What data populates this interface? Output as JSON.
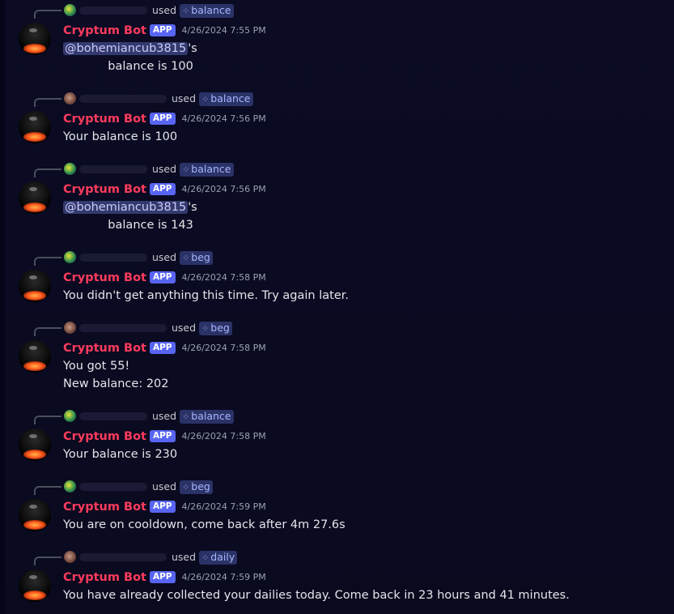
{
  "bot_name": "Cryptum Bot",
  "app_badge": "APP",
  "used_text": "used",
  "messages": [
    {
      "command": "balance",
      "timestamp": "4/26/2024 7:55 PM",
      "mention": "@bohemiancub3815",
      "suffix": "'s",
      "line2": "            balance is 100"
    },
    {
      "command": "balance",
      "timestamp": "4/26/2024 7:56 PM",
      "line1": "Your balance is 100"
    },
    {
      "command": "balance",
      "timestamp": "4/26/2024 7:56 PM",
      "mention": "@bohemiancub3815",
      "suffix": "'s",
      "line2": "            balance is 143"
    },
    {
      "command": "beg",
      "timestamp": "4/26/2024 7:58 PM",
      "line1": "You didn't get anything this time. Try again later."
    },
    {
      "command": "beg",
      "timestamp": "4/26/2024 7:58 PM",
      "line1": "You got 55!",
      "line2": "New balance: 202"
    },
    {
      "command": "balance",
      "timestamp": "4/26/2024 7:58 PM",
      "line1": "Your balance is 230"
    },
    {
      "command": "beg",
      "timestamp": "4/26/2024 7:59 PM",
      "line1": "You are on cooldown, come back after 4m 27.6s"
    },
    {
      "command": "daily",
      "timestamp": "4/26/2024 7:59 PM",
      "line1": "You have already collected your dailies today. Come back in 23 hours and 41 minutes."
    }
  ],
  "colors": {
    "bot_name": "#ff3b5c",
    "app_badge": "#5865f2",
    "command_bg": "#2a3266",
    "mention_bg": "#34396e"
  }
}
